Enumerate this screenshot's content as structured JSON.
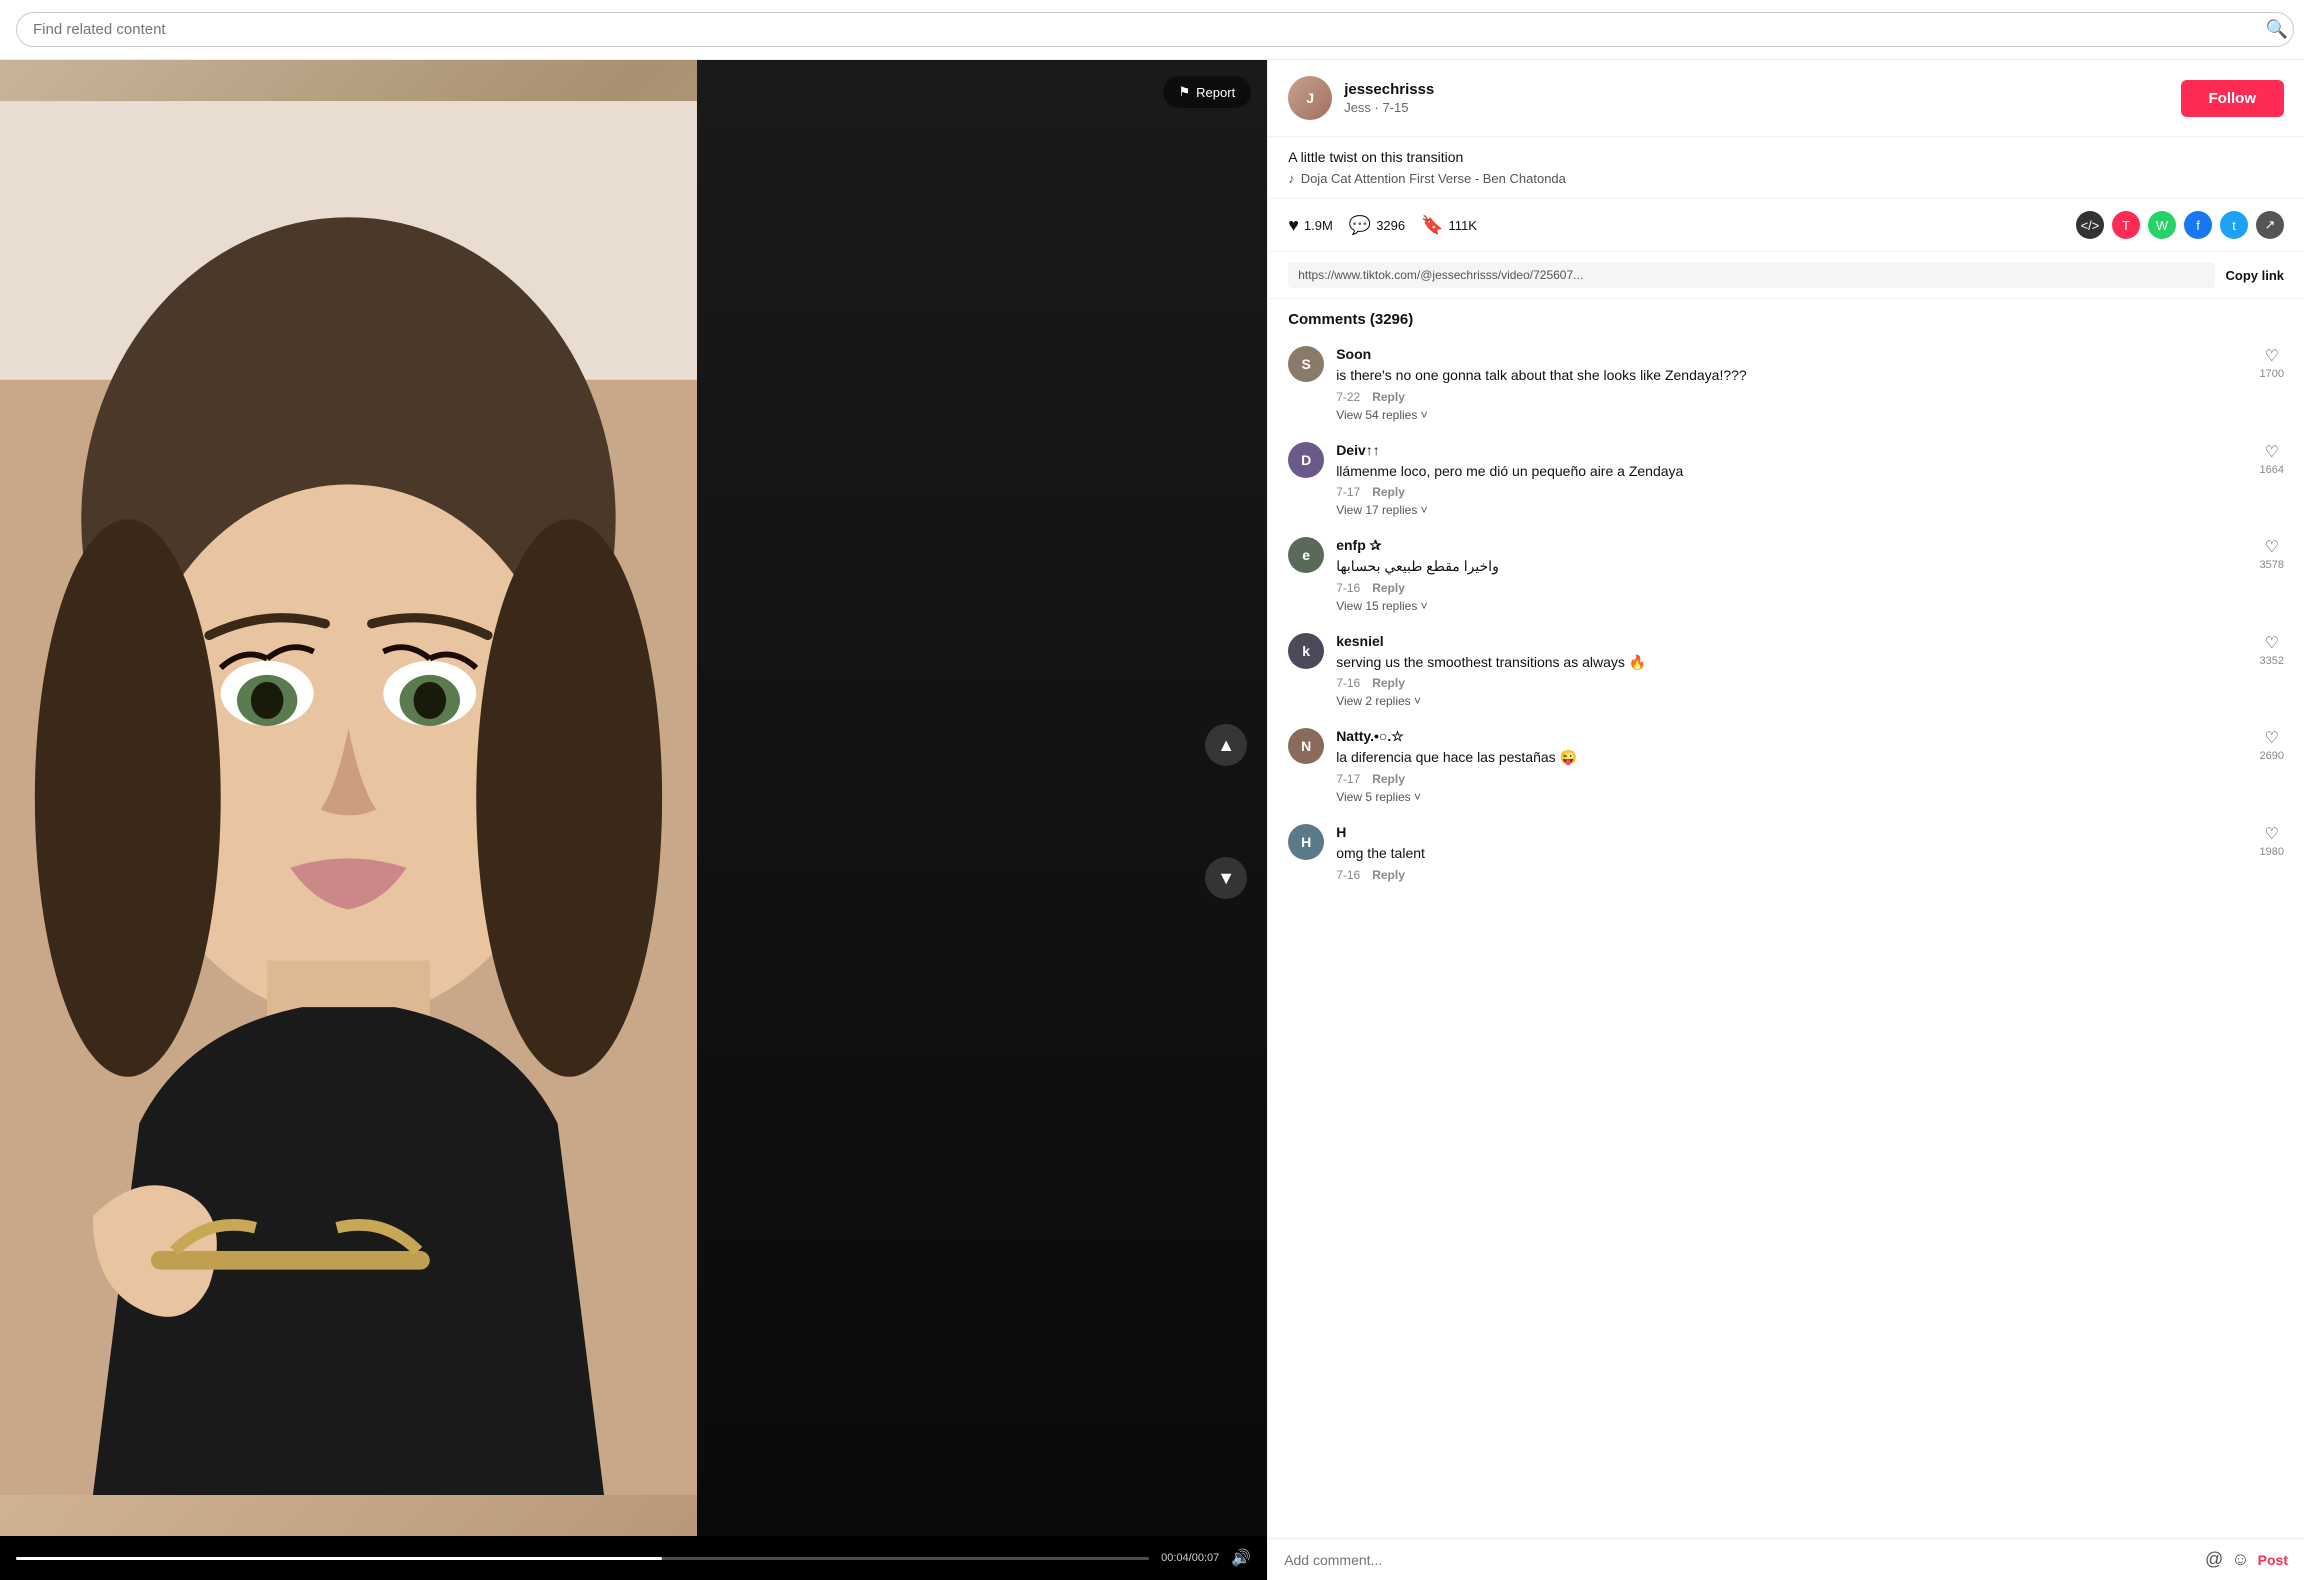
{
  "search": {
    "placeholder": "Find related content"
  },
  "report": {
    "label": "Report"
  },
  "video": {
    "time_current": "0:04",
    "time_total": "0:07",
    "time_display": "00:04/00:07"
  },
  "user": {
    "username": "jessechrisss",
    "display_name": "Jess",
    "meta": "Jess · 7-15",
    "avatar_initial": "J"
  },
  "follow_button": "Follow",
  "post": {
    "caption": "A little twist on this transition",
    "music_note": "♪",
    "music": "Doja Cat Attention First Verse - Ben Chatonda"
  },
  "actions": {
    "likes": "1.9M",
    "comments": "3296",
    "bookmarks": "111K"
  },
  "link": {
    "url": "https://www.tiktok.com/@jessechrisss/video/725607...",
    "copy_label": "Copy link"
  },
  "comments_header": "Comments (3296)",
  "comments": [
    {
      "id": 1,
      "username": "Soon",
      "text": "is there's no one gonna talk about that she looks like Zendaya!???",
      "date": "7-22",
      "likes": "1700",
      "replies": "View 54 replies",
      "avatar_color": "#8a7a6a",
      "avatar_initial": "S"
    },
    {
      "id": 2,
      "username": "Deiv↑↑",
      "text": "llámenme loco, pero me dió un pequeño aire a Zendaya",
      "date": "7-17",
      "likes": "1664",
      "replies": "View 17 replies",
      "avatar_color": "#6a5a8a",
      "avatar_initial": "D"
    },
    {
      "id": 3,
      "username": "enfp ✰",
      "text": "واخيرا مقطع طبيعي بحسابها",
      "date": "7-16",
      "likes": "3578",
      "replies": "View 15 replies",
      "avatar_color": "#5a6a5a",
      "avatar_initial": "e"
    },
    {
      "id": 4,
      "username": "kesniel",
      "text": "serving us the smoothest transitions as always 🔥",
      "date": "7-16",
      "likes": "3352",
      "replies": "View 2 replies",
      "avatar_color": "#4a4a5a",
      "avatar_initial": "k"
    },
    {
      "id": 5,
      "username": "Natty.•○.☆",
      "text": "la diferencia que hace las pestañas 😜",
      "date": "7-17",
      "likes": "2690",
      "replies": "View 5 replies",
      "avatar_color": "#8a6a5a",
      "avatar_initial": "N"
    },
    {
      "id": 6,
      "username": "H",
      "text": "omg the talent",
      "date": "7-16",
      "likes": "1980",
      "replies": null,
      "avatar_color": "#5a7a8a",
      "avatar_initial": "H"
    }
  ],
  "add_comment": {
    "placeholder": "Add comment...",
    "post_label": "Post"
  }
}
